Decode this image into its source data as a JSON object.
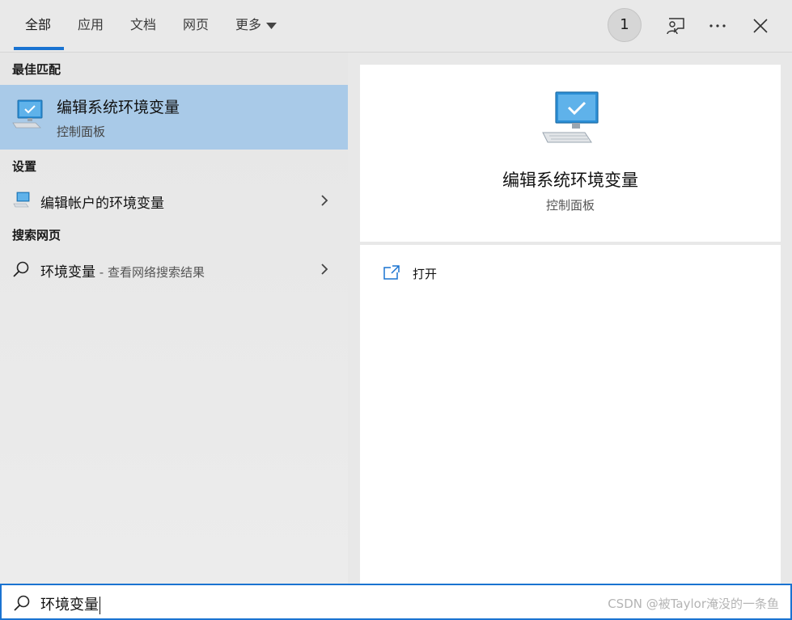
{
  "tabs": [
    {
      "label": "全部",
      "active": true
    },
    {
      "label": "应用",
      "active": false
    },
    {
      "label": "文档",
      "active": false
    },
    {
      "label": "网页",
      "active": false
    },
    {
      "label": "更多",
      "active": false
    }
  ],
  "header": {
    "badge_count": "1",
    "icons": [
      "feedback-icon",
      "more-options-icon",
      "close-icon"
    ]
  },
  "sections": {
    "best_match": "最佳匹配",
    "settings": "设置",
    "web_search": "搜索网页"
  },
  "best_match_item": {
    "title": "编辑系统环境变量",
    "subtitle": "控制面板",
    "icon": "monitor-check-icon"
  },
  "settings_item": {
    "label": "编辑帐户的环境变量",
    "icon": "settings-monitor-icon"
  },
  "web_item": {
    "query": "环境变量",
    "suffix": " - 查看网络搜索结果",
    "icon": "search-icon"
  },
  "preview": {
    "title": "编辑系统环境变量",
    "subtitle": "控制面板",
    "icon": "monitor-check-icon"
  },
  "actions": [
    {
      "label": "打开",
      "icon": "open-external-icon"
    }
  ],
  "search": {
    "value": "环境变量",
    "watermark": "CSDN @被Taylor淹没的一条鱼"
  },
  "colors": {
    "accent": "#1a73d1",
    "selection": "#a9cae8",
    "panel": "#e8e8e8"
  }
}
